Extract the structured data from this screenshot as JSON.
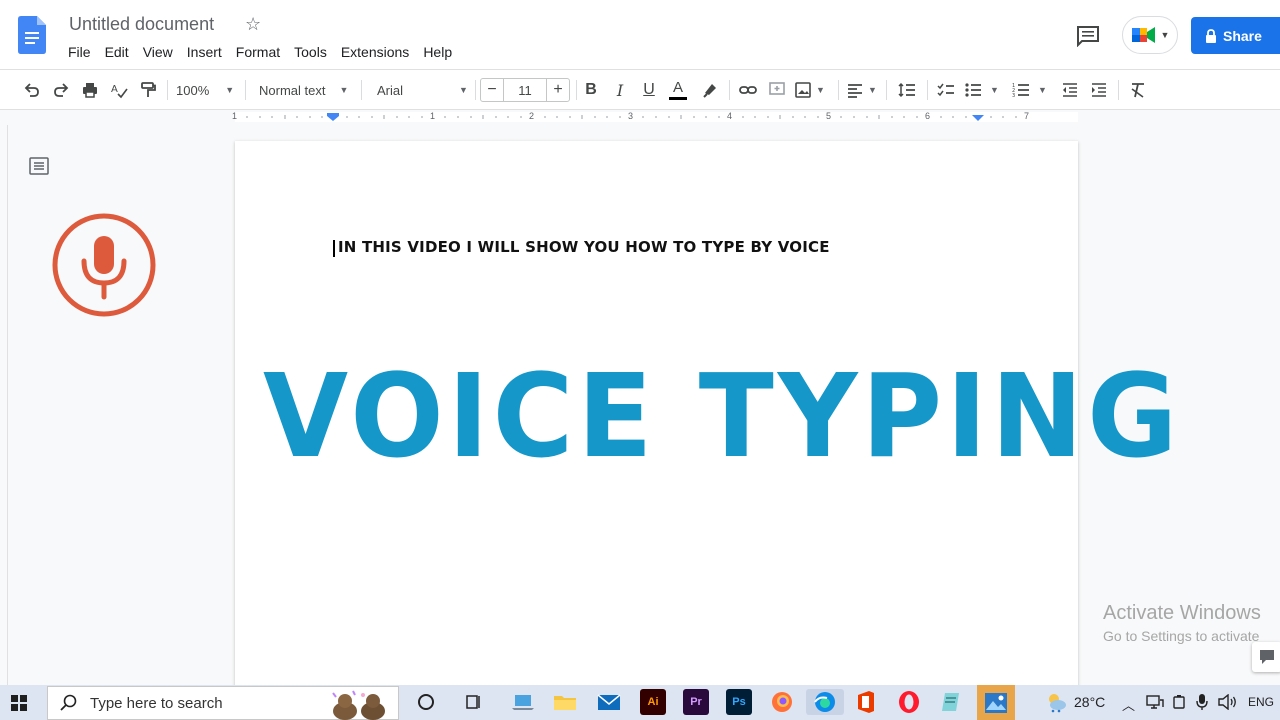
{
  "header": {
    "title": "Untitled document",
    "menus": [
      "File",
      "Edit",
      "View",
      "Insert",
      "Format",
      "Tools",
      "Extensions",
      "Help"
    ],
    "share_label": "Share"
  },
  "toolbar": {
    "zoom": "100%",
    "style": "Normal text",
    "font": "Arial",
    "font_size": "11"
  },
  "ruler": {
    "labels": [
      "1",
      "1",
      "2",
      "3",
      "4",
      "5",
      "6",
      "7"
    ]
  },
  "document": {
    "headline": "IN THIS VIDEO I WILL SHOW YOU HOW TO TYPE BY VOICE",
    "overlay_title": "VOICE TYPING",
    "overlay_color": "#1597c9",
    "mic_color": "#dd5a3c"
  },
  "watermark": {
    "line1": "Activate Windows",
    "line2": "Go to Settings to activate"
  },
  "taskbar": {
    "search_placeholder": "Type here to search",
    "temperature": "28°C",
    "language": "ENG",
    "apps": [
      "file-explorer",
      "mail",
      "illustrator",
      "premiere-pro",
      "photoshop",
      "firefox",
      "edge",
      "office",
      "opera",
      "notepad",
      "photos"
    ]
  },
  "colors": {
    "accent": "#1a73e8",
    "docs_blue": "#4285f4"
  }
}
